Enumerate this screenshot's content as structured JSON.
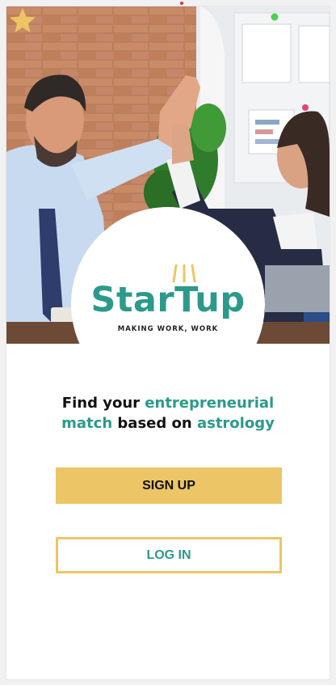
{
  "brand": {
    "name": "StarTup",
    "tagline": "MAKING WORK, WORK",
    "accent_color": "#2b9a8b",
    "gold_color": "#ecc566",
    "logo_icon": "shooting-star-icon"
  },
  "hero": {
    "image": "two-colleagues-high-five-photo"
  },
  "headline": {
    "part1": "Find your ",
    "highlight1": "entrepreneurial",
    "highlight2": "match",
    "part2": " based on ",
    "highlight3": "astrology"
  },
  "actions": {
    "signup_label": "SIGN UP",
    "login_label": "LOG IN"
  }
}
